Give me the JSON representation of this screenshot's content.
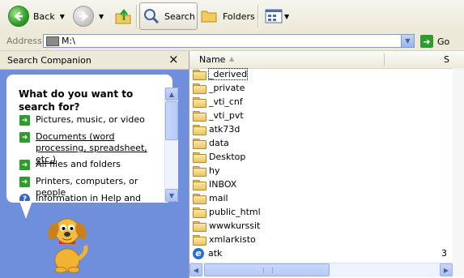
{
  "toolbar": {
    "back_label": "Back",
    "search_label": "Search",
    "folders_label": "Folders"
  },
  "address": {
    "label": "Address",
    "value": "M:\\",
    "go_label": "Go"
  },
  "companion": {
    "title": "Search Companion",
    "close": "×",
    "question": "What do you want to search for?",
    "options": [
      {
        "label": "Pictures, music, or video"
      },
      {
        "label": "Documents (word processing, spreadsheet, etc.)"
      },
      {
        "label": "All files and folders"
      },
      {
        "label": "Printers, computers, or people"
      },
      {
        "label": "Information in Help and"
      }
    ]
  },
  "filelist": {
    "col_name": "Name",
    "col_size": "S",
    "items": [
      {
        "name": "_derived",
        "icon": "folder-icon"
      },
      {
        "name": "_private",
        "icon": "folder-icon"
      },
      {
        "name": "_vti_cnf",
        "icon": "folder-icon"
      },
      {
        "name": "_vti_pvt",
        "icon": "folder-icon"
      },
      {
        "name": "atk73d",
        "icon": "folder-icon"
      },
      {
        "name": "data",
        "icon": "folder-icon"
      },
      {
        "name": "Desktop",
        "icon": "folder-icon"
      },
      {
        "name": "hy",
        "icon": "folder-icon"
      },
      {
        "name": "INBOX",
        "icon": "folder-icon"
      },
      {
        "name": "mail",
        "icon": "folder-icon"
      },
      {
        "name": "public_html",
        "icon": "folder-icon"
      },
      {
        "name": "wwwkurssit",
        "icon": "folder-icon"
      },
      {
        "name": "xmlarkisto",
        "icon": "folder-icon"
      },
      {
        "name": "atk",
        "icon": "ie-document-icon",
        "size": "3"
      }
    ]
  },
  "colors": {
    "companion_bg": "#6f8edc",
    "toolbar_bg": "#ece9d8",
    "go_green": "#2e9c2a"
  }
}
